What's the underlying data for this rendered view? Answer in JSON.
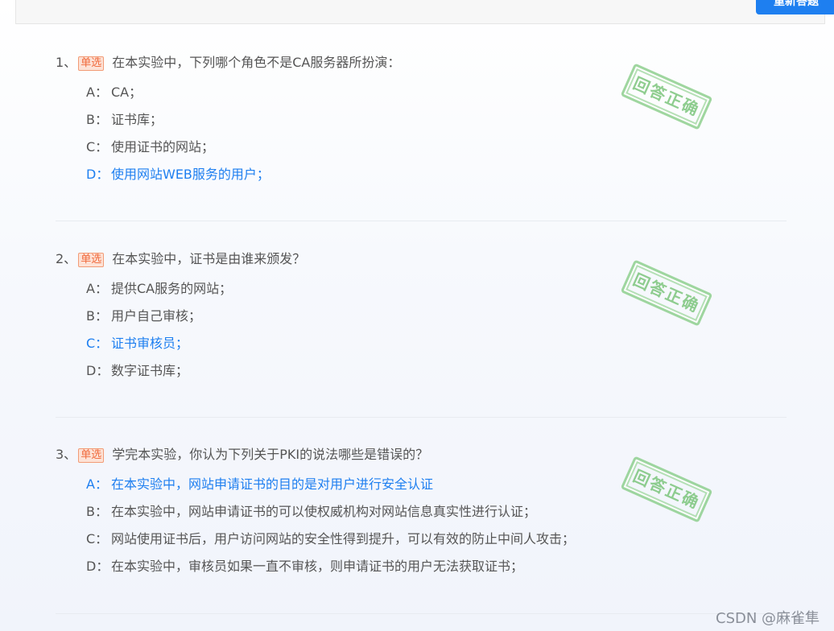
{
  "header": {
    "redo_label": "重新答题"
  },
  "stamp_text": "回答正确",
  "questions": [
    {
      "number": "1、",
      "type_badge": "单选",
      "text": "在本实验中，下列哪个角色不是CA服务器所扮演：",
      "selected": "D",
      "options": [
        {
          "letter": "A：",
          "text": "CA；"
        },
        {
          "letter": "B：",
          "text": "证书库；"
        },
        {
          "letter": "C：",
          "text": "使用证书的网站；"
        },
        {
          "letter": "D：",
          "text": "使用网站WEB服务的用户；"
        }
      ]
    },
    {
      "number": "2、",
      "type_badge": "单选",
      "text": "在本实验中，证书是由谁来颁发？",
      "selected": "C",
      "options": [
        {
          "letter": "A：",
          "text": "提供CA服务的网站；"
        },
        {
          "letter": "B：",
          "text": "用户自己审核；"
        },
        {
          "letter": "C：",
          "text": "证书审核员；"
        },
        {
          "letter": "D：",
          "text": "数字证书库；"
        }
      ]
    },
    {
      "number": "3、",
      "type_badge": "单选",
      "text": "学完本实验，你认为下列关于PKI的说法哪些是错误的？",
      "selected": "A",
      "options": [
        {
          "letter": "A：",
          "text": "在本实验中，网站申请证书的目的是对用户进行安全认证"
        },
        {
          "letter": "B：",
          "text": "在本实验中，网站申请证书的可以使权威机构对网站信息真实性进行认证；"
        },
        {
          "letter": "C：",
          "text": "网站使用证书后，用户访问网站的安全性得到提升，可以有效的防止中间人攻击；"
        },
        {
          "letter": "D：",
          "text": "在本实验中，审核员如果一直不审核，则申请证书的用户无法获取证书；"
        }
      ]
    }
  ],
  "watermark": "CSDN @麻雀隼",
  "colors": {
    "accent": "#1e7ff0",
    "badge": "#f06a3c",
    "stamp": "#7cc57c"
  }
}
